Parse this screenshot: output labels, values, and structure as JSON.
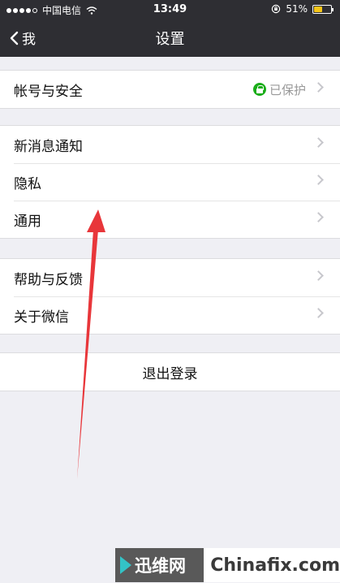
{
  "status_bar": {
    "carrier": "中国电信",
    "time": "13:49",
    "battery_text": "51%",
    "battery_fraction": 0.51
  },
  "nav": {
    "back_label": "我",
    "title": "设置"
  },
  "groups": {
    "account": {
      "label": "帐号与安全",
      "status": "已保护"
    },
    "notifications": {
      "label": "新消息通知"
    },
    "privacy": {
      "label": "隐私"
    },
    "general": {
      "label": "通用"
    },
    "help": {
      "label": "帮助与反馈"
    },
    "about": {
      "label": "关于微信"
    },
    "logout": {
      "label": "退出登录"
    }
  },
  "watermark": {
    "cn": "迅维网",
    "en": "Chinafix.com"
  },
  "colors": {
    "nav_bg": "#2e2e33",
    "page_bg": "#efeff4",
    "protected_green": "#1aad19",
    "annotation_red": "#e8363a",
    "watermark_accent": "#33c3c6"
  }
}
